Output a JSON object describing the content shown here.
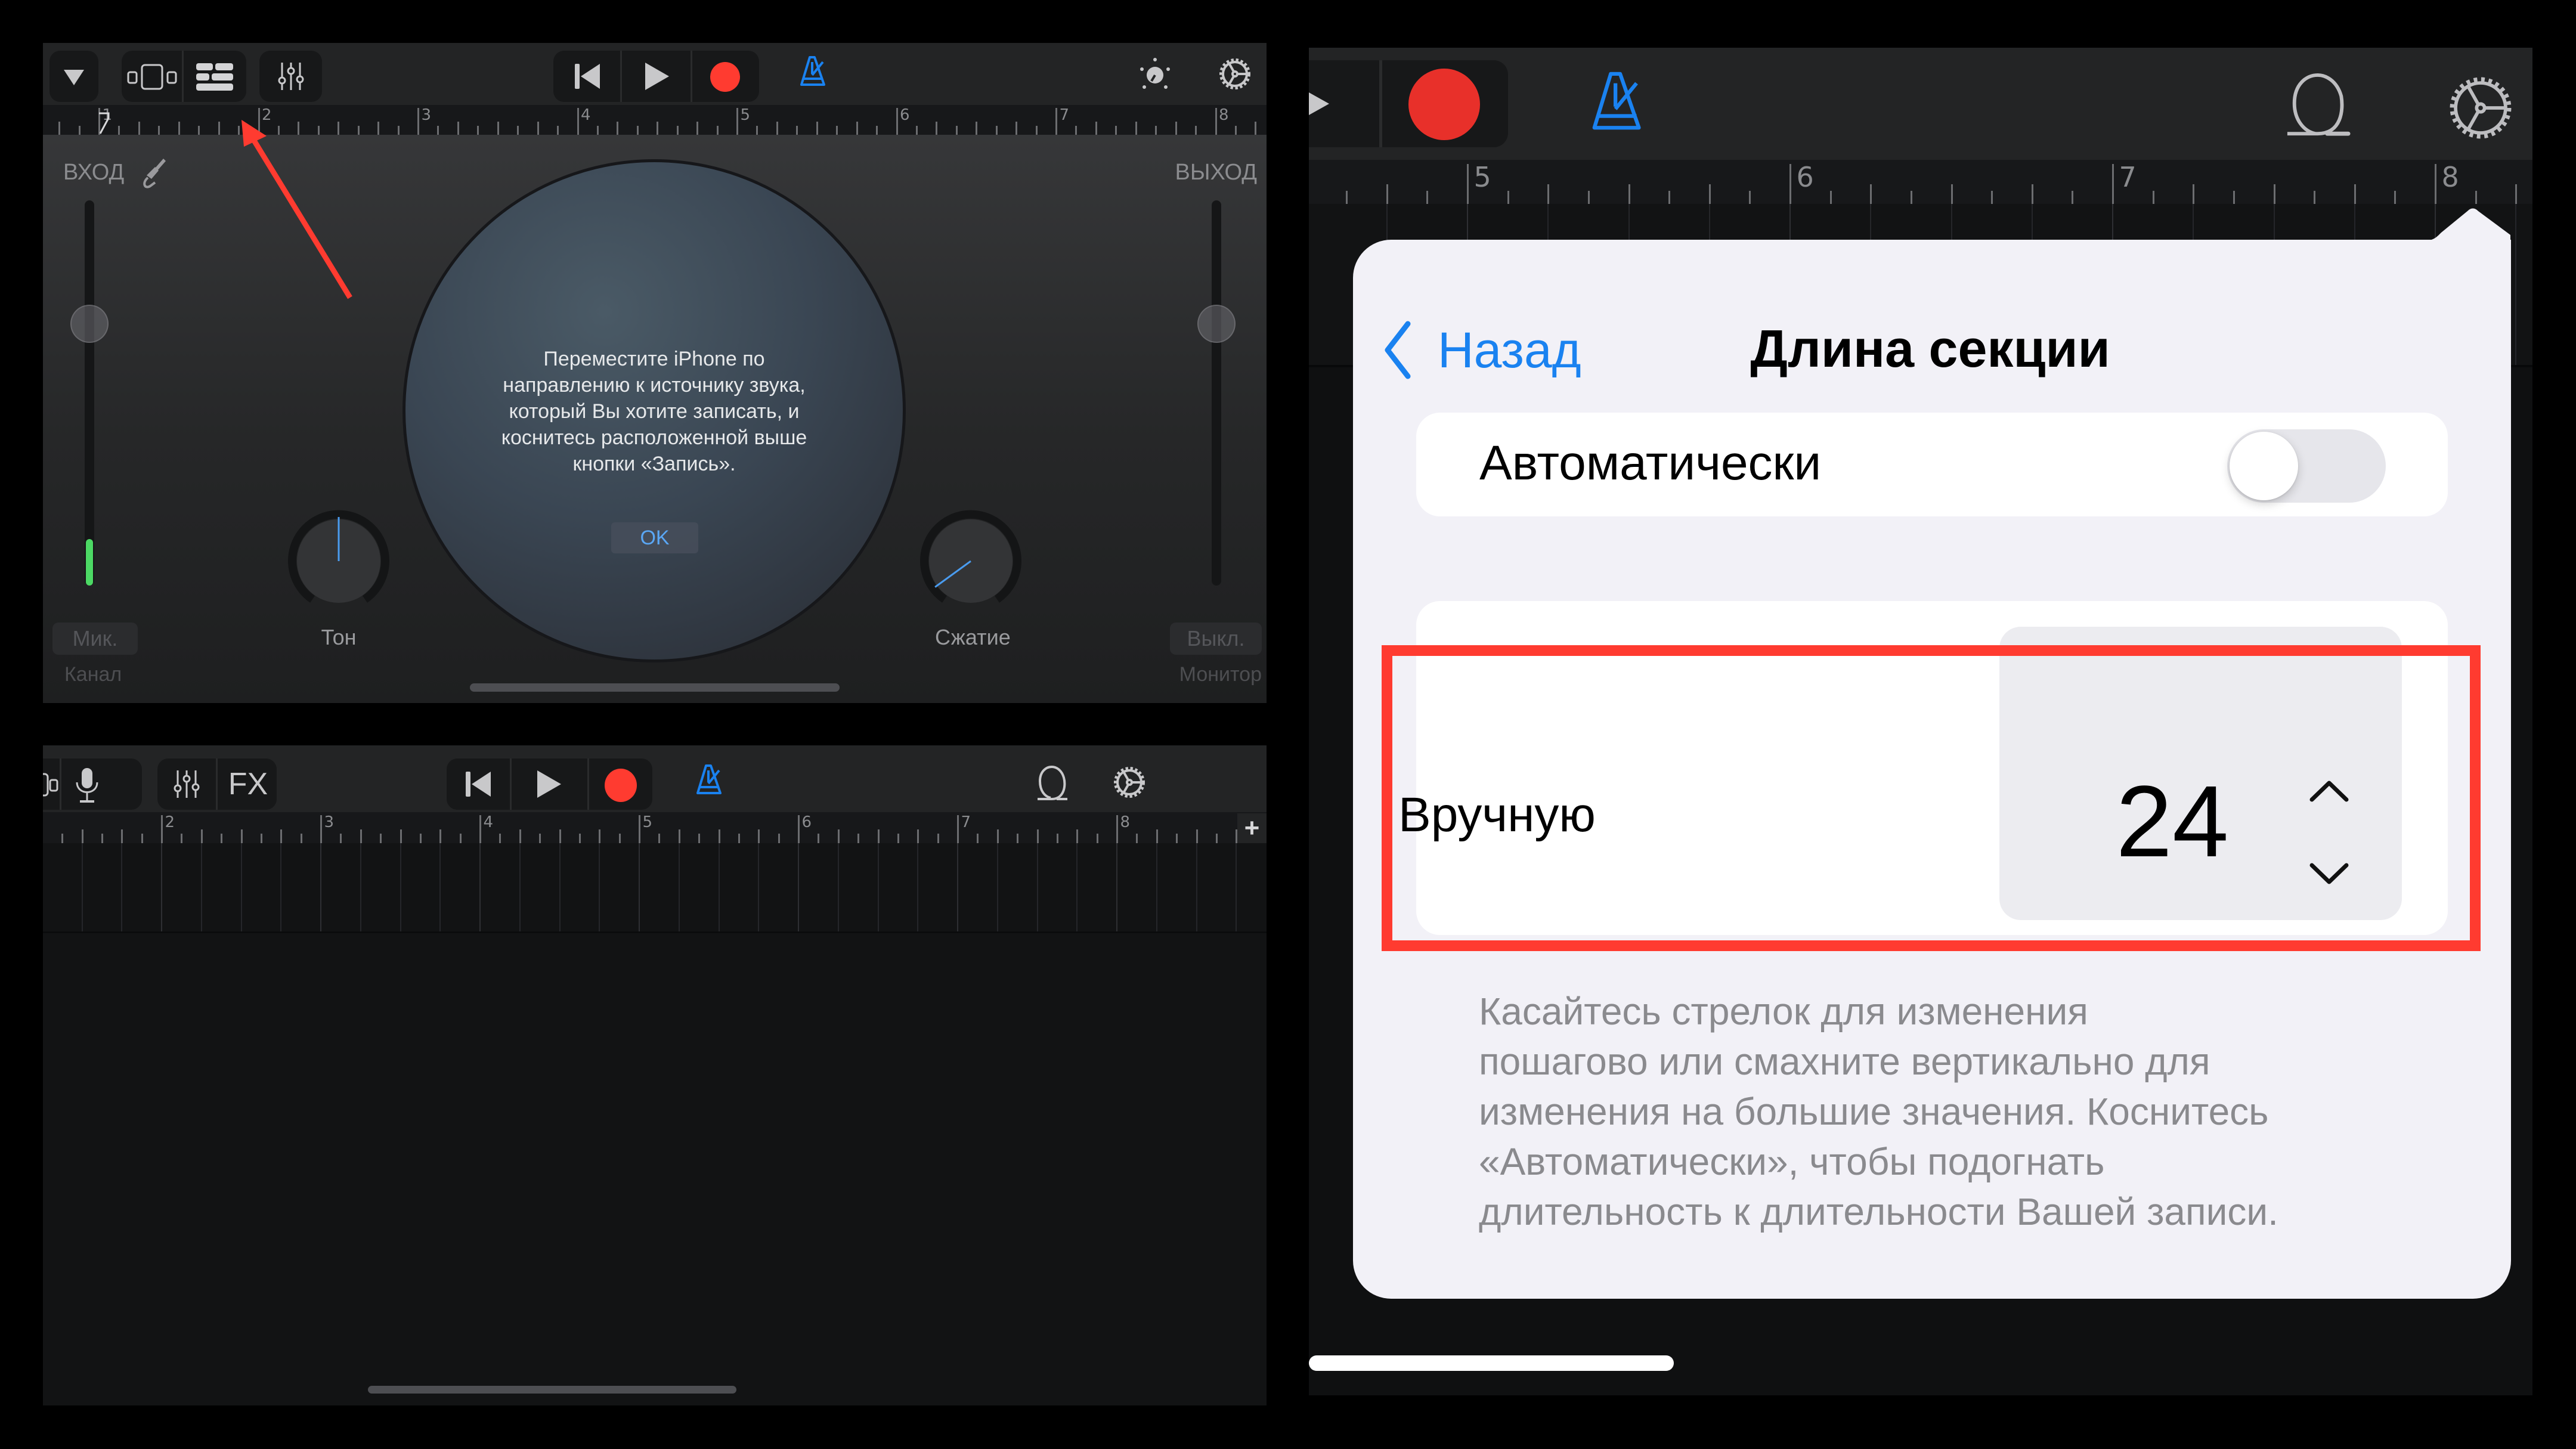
{
  "top_left_screen": {
    "toolbar": {
      "buttons": [
        "dropdown-icon",
        "track-view-icon",
        "tracks-list-icon",
        "mixer-icon",
        "rewind-icon",
        "play-icon",
        "record-icon",
        "metronome-icon",
        "tuner-knob-icon",
        "settings-gear-icon"
      ]
    },
    "ruler_bars": [
      "1",
      "2",
      "3",
      "4",
      "5",
      "6",
      "7",
      "8"
    ],
    "input_label": "ВХОД",
    "output_label": "ВЫХОД",
    "input_level_fraction": 0.12,
    "input_slider_fraction": 0.7,
    "output_slider_fraction": 0.7,
    "message_lines": [
      "Переместите iPhone по",
      "направлению к источнику звука,",
      "который Вы хотите записать, и",
      "коснитесь расположенной выше",
      "кнопки «Запись»."
    ],
    "ok_button": "OK",
    "knobs": [
      {
        "label": "Тон",
        "value_fraction": 0.5
      },
      {
        "label": "Сжатие",
        "value_fraction": 0.08
      }
    ],
    "channel_button": "Мик.",
    "channel_label": "Канал",
    "monitor_button": "Выкл.",
    "monitor_label": "Монитор"
  },
  "bottom_left_screen": {
    "toolbar_fx_label": "FX",
    "ruler_bars": [
      "2",
      "3",
      "4",
      "5",
      "6",
      "7",
      "8"
    ],
    "add_section_label": "+"
  },
  "right_screen": {
    "ruler_bars": [
      "5",
      "6",
      "7",
      "8"
    ],
    "popover": {
      "back_label": "Назад",
      "title": "Длина секции",
      "auto_label": "Автоматически",
      "auto_enabled": false,
      "manual_label": "Вручную",
      "manual_value": "24",
      "help_lines": [
        "Касайтесь стрелок для изменения",
        "пошагово или смахните вертикально для",
        "изменения на большие значения. Коснитесь",
        "«Автоматически», чтобы подогнать",
        "длительность к длительности Вашей записи."
      ]
    }
  },
  "colors": {
    "record": "#ff3b30",
    "accent_blue": "#1a82f0",
    "annotation_red": "#ff3b30",
    "meter_green": "#4cd964"
  }
}
